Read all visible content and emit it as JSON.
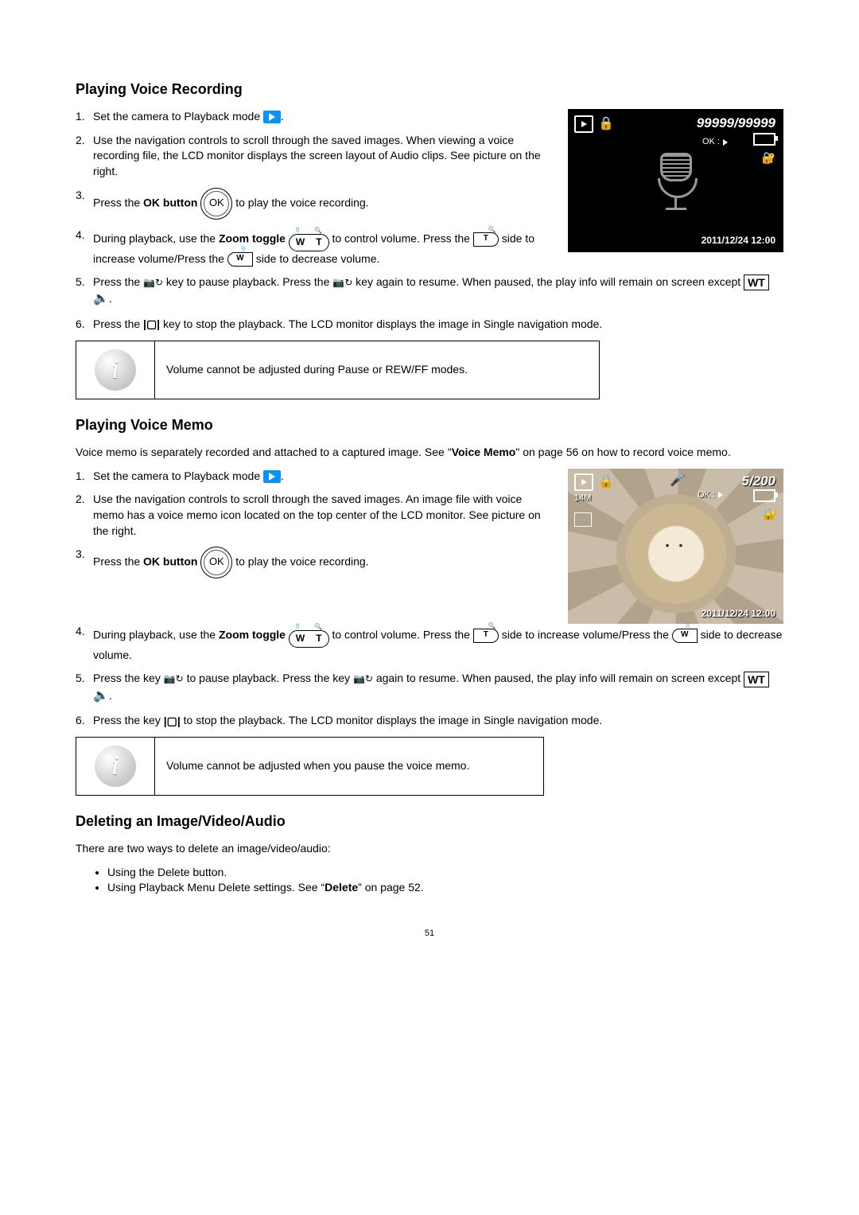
{
  "section1": {
    "heading": "Playing Voice Recording",
    "step1a": "Set the camera to Playback mode ",
    "step1b": ".",
    "step2": "Use the navigation controls to scroll through the saved images. When viewing a voice recording file, the LCD monitor displays the screen layout of Audio clips. See picture on the right.",
    "step3a": "Press the ",
    "ok_button": "OK button",
    "ok_badge": "OK",
    "step3b": " to play the voice recording.",
    "step4a": "During playback, use the ",
    "zoom_toggle": "Zoom toggle",
    "wt_w": "W",
    "wt_t": "T",
    "step4b": " to control volume. Press the ",
    "t_label": "T",
    "step4c": " side to increase volume/Press the ",
    "w_label": "W",
    "step4d": " side to decrease volume.",
    "step5a": "Press the ",
    "step5b": " key to pause playback. Press the ",
    "step5c": " key again to resume. When paused, the play info will remain on screen except ",
    "wt_box": "WT",
    "step5d": ".",
    "step6a": "Press the ",
    "step6b": " key to stop the playback. The LCD monitor displays the image in Single navigation mode.",
    "note": "Volume cannot be adjusted during Pause or REW/FF modes."
  },
  "lcd1": {
    "counter": "99999/99999",
    "ok": "OK :",
    "timestamp": "2011/12/24 12:00"
  },
  "section2": {
    "heading": "Playing Voice Memo",
    "intro_a": "Voice memo is separately recorded and attached to a captured image. See \"",
    "voice_memo": "Voice Memo",
    "intro_b": "\" on page 56 on how to record voice memo.",
    "step1a": "Set the camera to Playback mode ",
    "step1b": ".",
    "step2": "Use the navigation controls to scroll through the saved images. An image file with voice memo has a voice memo icon located on the top center of the LCD monitor. See picture on the right.",
    "step3a": "Press the ",
    "step3b": " to play the voice recording.",
    "step4a": "During playback, use the ",
    "step4b": " to control volume. Press the ",
    "step4c": " side to increase volume/Press the ",
    "step4d": " side to decrease volume.",
    "step5a": "Press the key ",
    "step5b": " to pause playback. Press the key ",
    "step5c": " again to resume. When paused, the play info will remain on screen except ",
    "step5d": ".",
    "step6a": "Press the key ",
    "step6b": " to stop the playback. The LCD monitor displays the image in Single navigation mode.",
    "note": "Volume cannot be adjusted when you pause the voice memo."
  },
  "lcd2": {
    "counter": "5/200",
    "ok": "OK :",
    "res": "14M",
    "timestamp": "2011/12/24 12:00"
  },
  "section3": {
    "heading": "Deleting an Image/Video/Audio",
    "intro": "There are two ways to delete an image/video/audio:",
    "bullet1": "Using the Delete button.",
    "bullet2a": "Using Playback Menu Delete settings. See “",
    "delete": "Delete",
    "bullet2b": "” on page 52."
  },
  "page_number": "51"
}
